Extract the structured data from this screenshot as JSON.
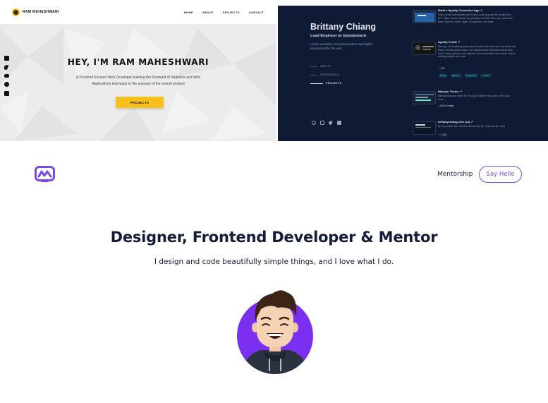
{
  "ram": {
    "brand": "RAM MAHESHWARI",
    "nav": [
      "HOME",
      "ABOUT",
      "PROJECTS",
      "CONTACT"
    ],
    "social_icons": [
      "linkedin-icon",
      "twitter-icon",
      "youtube-icon",
      "github-icon",
      "medium-icon"
    ],
    "title": "HEY, I'M RAM MAHESHWARI",
    "subtitle_line1": "A Frontend focused Web Developer building the Frontend of Websites and Web",
    "subtitle_line2": "Applications that leads to the success of the overall product",
    "cta": "PROJECTS",
    "colors": {
      "accent": "#f7c01a",
      "background": "#ececec"
    }
  },
  "brittany": {
    "name": "Brittany Chiang",
    "role": "Lead Engineer at Upstatement",
    "bio": "I build accessible, inclusive products and digital experiences for the web.",
    "nav": [
      {
        "label": "ABOUT",
        "active": false
      },
      {
        "label": "EXPERIENCE",
        "active": false
      },
      {
        "label": "PROJECTS",
        "active": true
      }
    ],
    "social_icons": [
      "github-icon",
      "instagram-icon",
      "twitter-icon",
      "linkedin-icon"
    ],
    "projects": [
      {
        "title": "Build a Spotify Connected App ↗",
        "desc": "Video course that teaches how to build a web app with the Spotify Web API. Topics covered include the principles of REST APIs, user auth flows, Node, Express, React, Styled Components, and more."
      },
      {
        "title": "Spotify Profile ↗",
        "desc": "Web app for visualizing personalized Spotify data. View your top artists, top tracks, recently played tracks, and detailed audio information about each track. Create and save new playlists of recommended tracks based on your existing playlists and more.",
        "stars": "☆ 642",
        "tags": [
          "React",
          "Express",
          "Spotify API",
          "Heroku"
        ]
      },
      {
        "title": "Halcyon Theme ↗",
        "desc": "Minimal dark blue theme for VS Code, Sublime Text, Atom, iTerm, and more.",
        "installs": "⤓ 100k+ Installs"
      },
      {
        "title": "brittanychiang.com (v4) ↗",
        "desc": "An old portfolio site built with Gatsby with 6k+ stars and 3k+ forks",
        "stars": "☆ 6,236"
      }
    ],
    "colors": {
      "background": "#0f1b34",
      "accent": "#5eead4"
    }
  },
  "adam": {
    "logo_icon": "adam-logo-icon",
    "nav_link": "Mentorship",
    "cta": "Say Hello",
    "title": "Designer, Frontend Developer & Mentor",
    "subtitle": "I design and code beautifully simple things, and I love what I do.",
    "colors": {
      "primary": "#7b4ae2",
      "text": "#141c3a"
    }
  }
}
